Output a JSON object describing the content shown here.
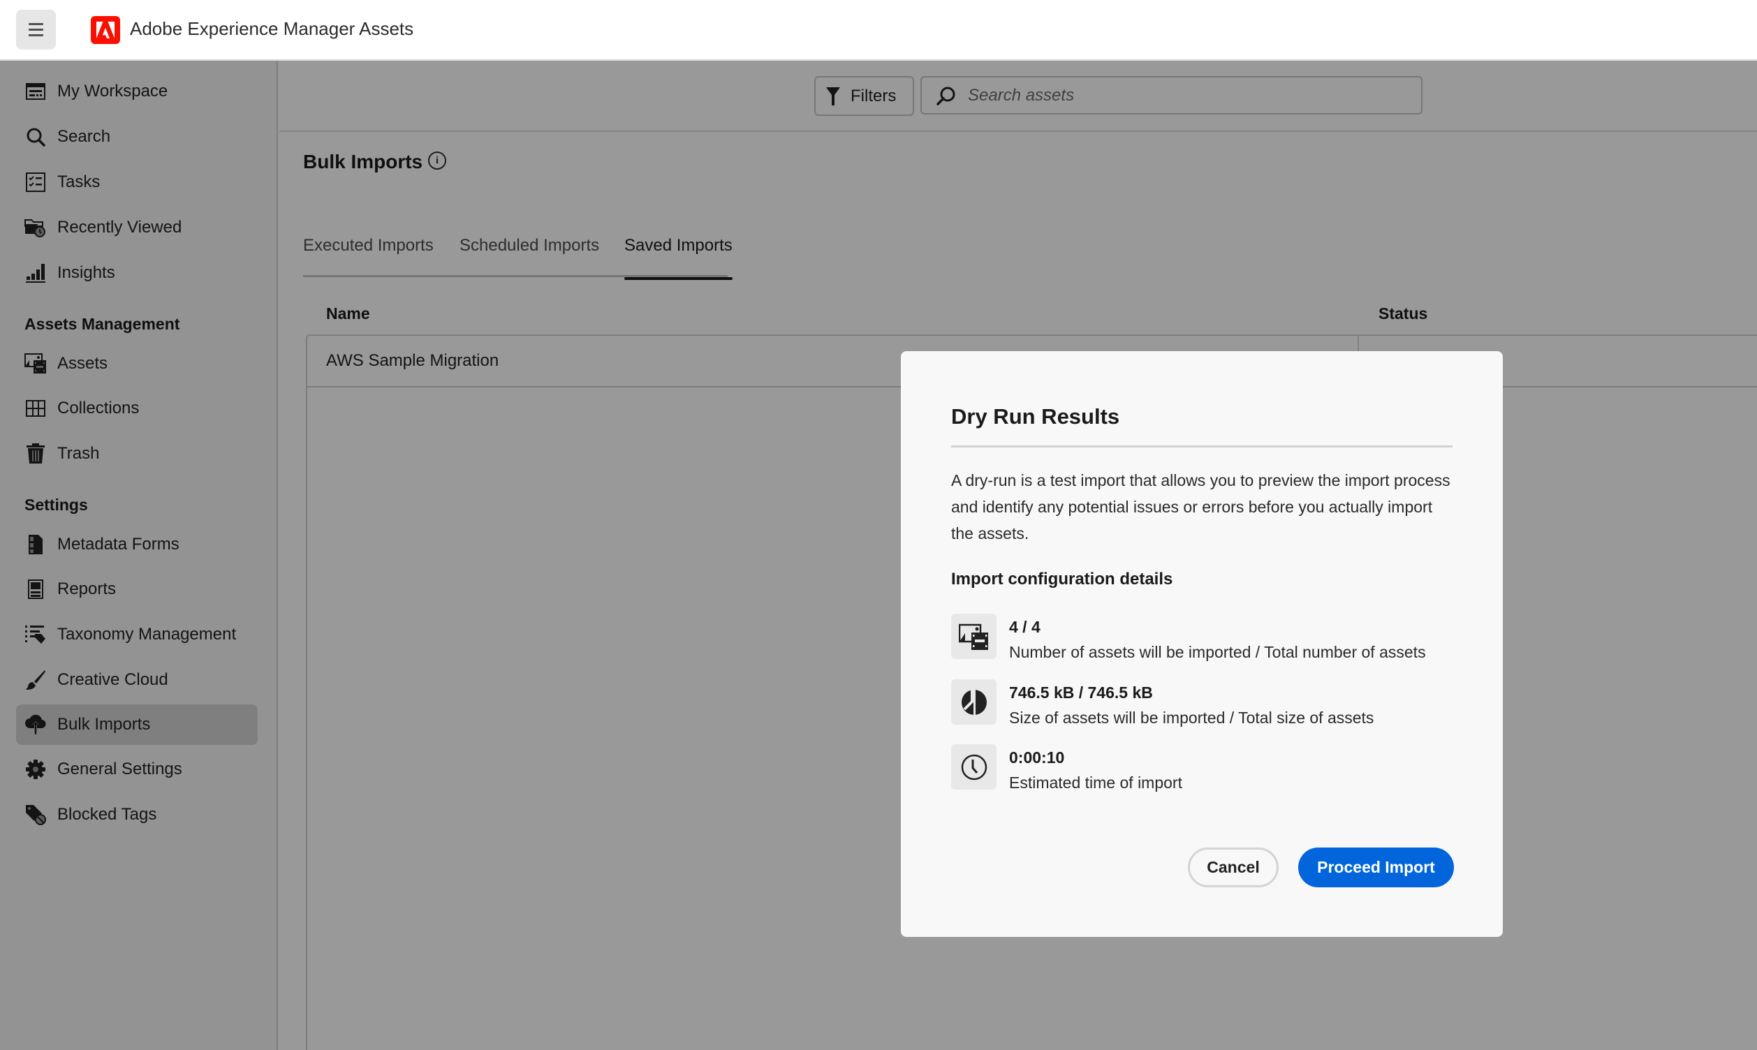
{
  "header": {
    "menu_icon": "hamburger-icon",
    "logo_icon": "adobe-logo",
    "title": "Adobe Experience Manager Assets",
    "brand_color": "#fa0f00"
  },
  "sidebar": {
    "items": [
      {
        "label": "My Workspace",
        "icon": "workspace-icon"
      },
      {
        "label": "Search",
        "icon": "search-icon"
      },
      {
        "label": "Tasks",
        "icon": "tasks-icon"
      },
      {
        "label": "Recently Viewed",
        "icon": "recent-folder-icon"
      },
      {
        "label": "Insights",
        "icon": "bar-chart-icon"
      }
    ],
    "sections": [
      {
        "title": "Assets Management",
        "items": [
          {
            "label": "Assets",
            "icon": "assets-icon"
          },
          {
            "label": "Collections",
            "icon": "grid-icon"
          },
          {
            "label": "Trash",
            "icon": "trash-icon"
          }
        ]
      },
      {
        "title": "Settings",
        "items": [
          {
            "label": "Metadata Forms",
            "icon": "form-icon"
          },
          {
            "label": "Reports",
            "icon": "report-icon"
          },
          {
            "label": "Taxonomy Management",
            "icon": "taxonomy-icon"
          },
          {
            "label": "Creative Cloud",
            "icon": "brush-icon"
          },
          {
            "label": "Bulk Imports",
            "icon": "cloud-upload-icon",
            "active": true
          },
          {
            "label": "General Settings",
            "icon": "gear-icon"
          },
          {
            "label": "Blocked Tags",
            "icon": "blocked-tag-icon"
          }
        ]
      }
    ]
  },
  "toolbar": {
    "filters_label": "Filters",
    "search_placeholder": "Search assets",
    "search_value": ""
  },
  "page": {
    "title": "Bulk Imports",
    "info_glyph": "i",
    "tabs": [
      {
        "label": "Executed Imports",
        "active": false
      },
      {
        "label": "Scheduled Imports",
        "active": false
      },
      {
        "label": "Saved Imports",
        "active": true
      }
    ],
    "table": {
      "columns": [
        "Name",
        "Status"
      ],
      "rows": [
        {
          "name": "AWS Sample Migration",
          "status": ""
        }
      ]
    }
  },
  "dialog": {
    "title": "Dry Run Results",
    "description": "A dry-run is a test import that allows you to preview the import process and identify any potential issues or errors before you actually import the assets.",
    "subtitle": "Import configuration details",
    "details": [
      {
        "icon": "assets-icon",
        "value": "4 / 4",
        "description": "Number of assets will be imported / Total number of assets"
      },
      {
        "icon": "pie-chart-icon",
        "value": "746.5 kB / 746.5 kB",
        "description": "Size of assets will be imported / Total size of assets"
      },
      {
        "icon": "clock-icon",
        "value": "0:00:10",
        "description": "Estimated time of import"
      }
    ],
    "cancel_label": "Cancel",
    "proceed_label": "Proceed Import",
    "accent_color": "#0265dc"
  }
}
